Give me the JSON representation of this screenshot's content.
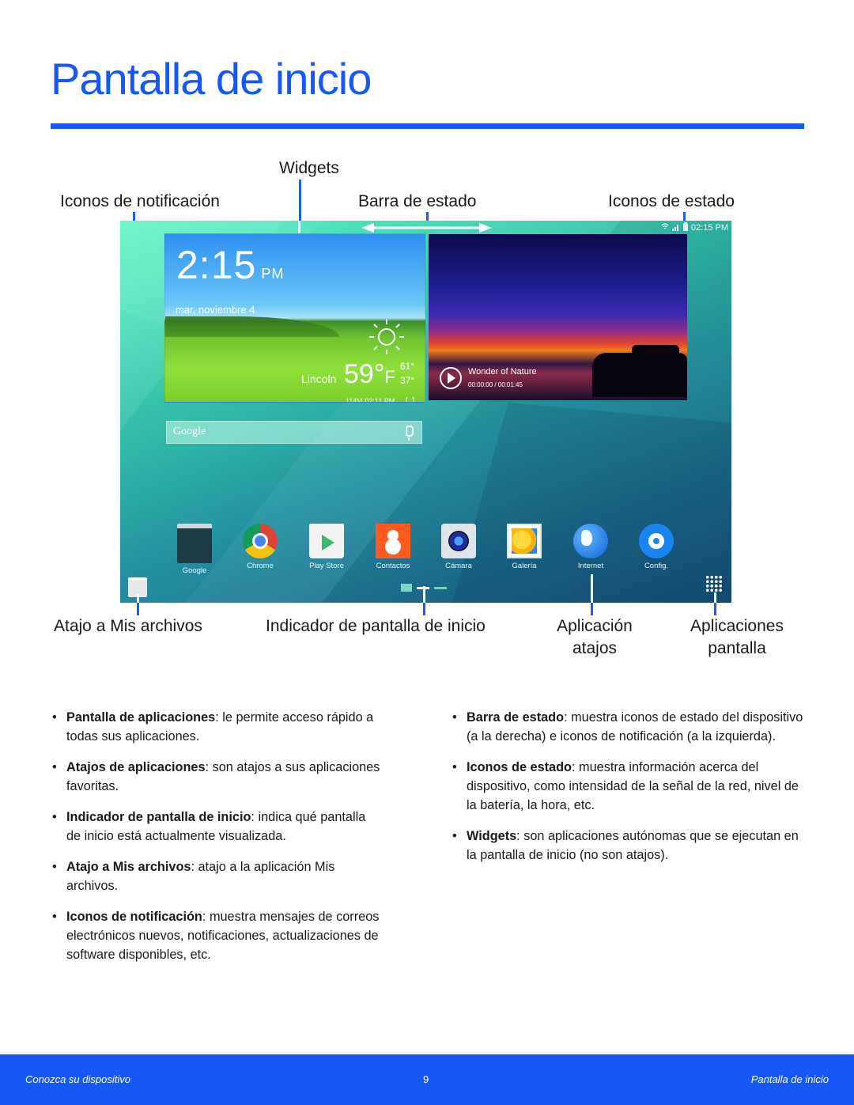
{
  "page": {
    "title": "Pantalla de inicio",
    "accent_color": "#1558f5"
  },
  "callouts": {
    "widgets": "Widgets",
    "notification_icons": "Iconos de notificación",
    "status_bar": "Barra de estado",
    "status_icons": "Iconos de estado",
    "my_files_shortcut": "Atajo a Mis archivos",
    "home_indicator": "Indicador de pantalla de inicio",
    "app_shortcuts_line1": "Aplicación",
    "app_shortcuts_line2": "atajos",
    "apps_screen_line1": "Aplicaciones",
    "apps_screen_line2": "pantalla"
  },
  "device": {
    "statusbar": {
      "icons": [
        "wifi-icon",
        "signal-icon",
        "battery-icon"
      ],
      "time": "02:15 PM"
    },
    "clock_widget": {
      "time": "2:15",
      "ampm": "PM",
      "date": "mar, noviembre 4",
      "city": "Lincoln",
      "temperature": "59°",
      "unit": "F",
      "high": "61°",
      "low": "37°",
      "updated": "11/04 02:11 PM",
      "weather_icon": "sun-icon"
    },
    "video_widget": {
      "title": "Wonder of Nature",
      "time": "00:00:00 / 00:01:45"
    },
    "search_bar": {
      "label": "Google"
    },
    "apps": [
      {
        "label": "Google",
        "icon": "google-folder-icon"
      },
      {
        "label": "Chrome",
        "icon": "chrome-icon"
      },
      {
        "label": "Play Store",
        "icon": "play-store-icon"
      },
      {
        "label": "Contactos",
        "icon": "contacts-icon"
      },
      {
        "label": "Cámara",
        "icon": "camera-icon"
      },
      {
        "label": "Galería",
        "icon": "gallery-icon"
      },
      {
        "label": "Internet",
        "icon": "internet-icon"
      },
      {
        "label": "Config.",
        "icon": "settings-icon"
      }
    ]
  },
  "bullets_left": [
    {
      "term": "Pantalla de aplicaciones",
      "text": ": le permite acceso rápido a todas sus aplicaciones."
    },
    {
      "term": "Atajos de aplicaciones",
      "text": ": son atajos a sus aplicaciones favoritas."
    },
    {
      "term": "Indicador de pantalla de inicio",
      "text": ": indica qué pantalla de inicio está actualmente visualizada."
    },
    {
      "term": "Atajo a Mis archivos",
      "text": ": atajo a la aplicación Mis archivos."
    },
    {
      "term": "Iconos de notificación",
      "text": ": muestra mensajes de correos electrónicos nuevos, notificaciones, actualizaciones de software disponibles, etc."
    }
  ],
  "bullets_right": [
    {
      "term": "Barra de estado",
      "text": ": muestra iconos de estado del dispositivo (a la derecha) e iconos de notificación (a la izquierda)."
    },
    {
      "term": "Iconos de estado",
      "text": ": muestra información acerca del dispositivo, como intensidad de la señal de la red, nivel de la batería, la hora, etc."
    },
    {
      "term": "Widgets",
      "text": ": son aplicaciones autónomas que se ejecutan en la pantalla de inicio (no son atajos)."
    }
  ],
  "footer": {
    "left": "Conozca su dispositivo",
    "page_number": "9",
    "right": "Pantalla de inicio"
  }
}
